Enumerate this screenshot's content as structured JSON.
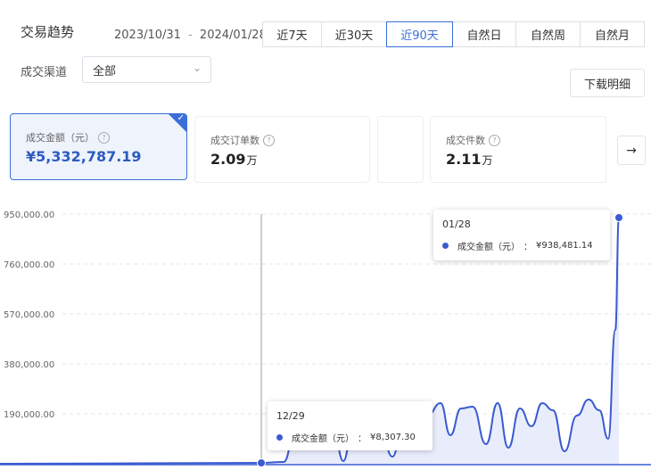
{
  "header": {
    "title": "交易趋势",
    "date_start": "2023/10/31",
    "date_sep": "-",
    "date_end": "2024/01/28",
    "range_buttons": [
      "近7天",
      "近30天",
      "近90天",
      "自然日",
      "自然周",
      "自然月"
    ],
    "active_range": "近90天"
  },
  "filter": {
    "channel_label": "成交渠道",
    "channel_value": "全部",
    "download_label": "下载明细"
  },
  "metrics": [
    {
      "label": "成交金额（元）",
      "value": "¥5,332,787.19",
      "selected": true
    },
    {
      "label": "成交订单数",
      "value": "2.09",
      "unit": "万",
      "selected": false
    },
    {
      "label": "成交件数",
      "value": "2.11",
      "unit": "万",
      "selected": false
    }
  ],
  "colors": {
    "accent": "#3a6fd8",
    "line": "#3a5bd1",
    "area": "#e9edfb"
  },
  "chart_data": {
    "type": "area",
    "series": [
      {
        "name": "成交金额（元）"
      }
    ],
    "y_ticks": [
      "950,000.00",
      "760,000.00",
      "570,000.00",
      "380,000.00",
      "190,000.00"
    ],
    "ylim": [
      0,
      950000
    ],
    "grid": true,
    "tooltips": [
      {
        "date": "01/28",
        "series": "成交金额（元）",
        "sep": "：",
        "value": "¥938,481.14"
      },
      {
        "date": "12/29",
        "series": "成交金额（元）",
        "sep": "：",
        "value": "¥8,307.30"
      }
    ]
  }
}
